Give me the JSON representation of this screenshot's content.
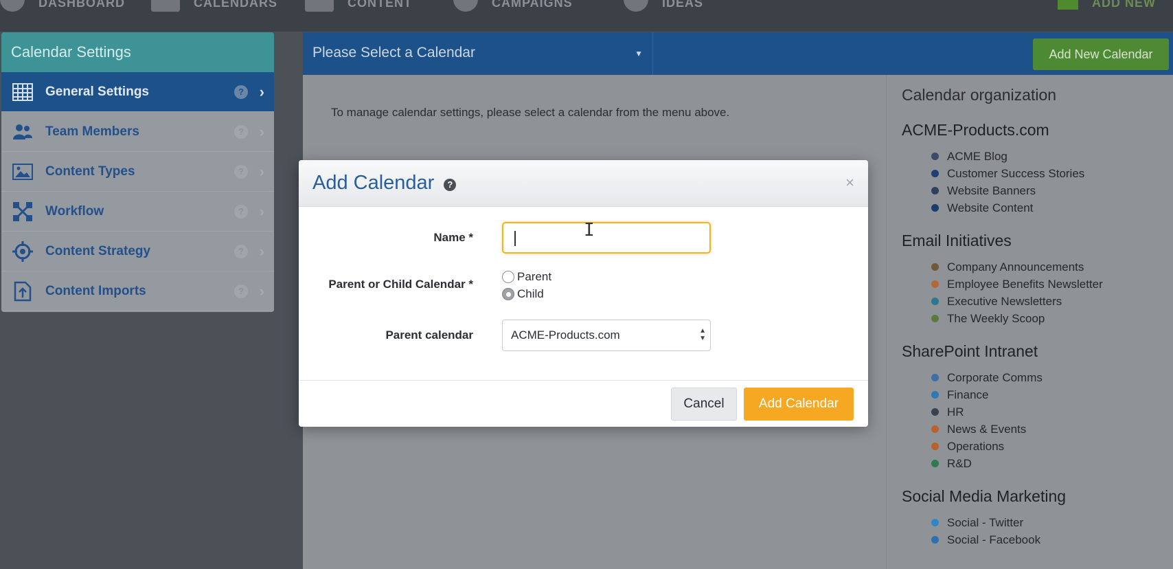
{
  "topnav": {
    "items": [
      {
        "label": "DASHBOARD",
        "icon": "dashboard-icon"
      },
      {
        "label": "CALENDARS",
        "icon": "calendar-grid-icon"
      },
      {
        "label": "CONTENT",
        "icon": "content-icon"
      },
      {
        "label": "CAMPAIGNS",
        "icon": "star-icon"
      },
      {
        "label": "IDEAS",
        "icon": "lightbulb-icon"
      }
    ],
    "add_new": "ADD NEW"
  },
  "sidebar": {
    "title": "Calendar Settings",
    "items": [
      {
        "label": "General Settings",
        "icon": "grid-icon",
        "active": true
      },
      {
        "label": "Team Members",
        "icon": "team-icon"
      },
      {
        "label": "Content Types",
        "icon": "image-icon"
      },
      {
        "label": "Workflow",
        "icon": "workflow-icon"
      },
      {
        "label": "Content Strategy",
        "icon": "target-icon"
      },
      {
        "label": "Content Imports",
        "icon": "import-icon"
      }
    ]
  },
  "main": {
    "calendar_select": "Please Select a Calendar",
    "add_new_calendar": "Add New Calendar",
    "message": "To manage calendar settings, please select a calendar from the menu above."
  },
  "organization": {
    "title": "Calendar organization",
    "groups": [
      {
        "name": "ACME-Products.com",
        "items": [
          {
            "label": "ACME Blog",
            "color": "#3b4a66"
          },
          {
            "label": "Customer Success Stories",
            "color": "#1f3f74"
          },
          {
            "label": "Website Banners",
            "color": "#2f3f5c"
          },
          {
            "label": "Website Content",
            "color": "#1d3c6e"
          }
        ]
      },
      {
        "name": "Email Initiatives",
        "items": [
          {
            "label": "Company Announcements",
            "color": "#6d5a3a"
          },
          {
            "label": "Employee Benefits Newsletter",
            "color": "#b3683a"
          },
          {
            "label": "Executive Newsletters",
            "color": "#2f7690"
          },
          {
            "label": "The Weekly Scoop",
            "color": "#5b7a3b"
          }
        ]
      },
      {
        "name": "SharePoint Intranet",
        "items": [
          {
            "label": "Corporate Comms",
            "color": "#3d6fa3"
          },
          {
            "label": "Finance",
            "color": "#2f78b0"
          },
          {
            "label": "HR",
            "color": "#3a4250"
          },
          {
            "label": "News & Events",
            "color": "#b8622e"
          },
          {
            "label": "Operations",
            "color": "#b8622e"
          },
          {
            "label": "R&D",
            "color": "#2e7a52"
          }
        ]
      },
      {
        "name": "Social Media Marketing",
        "items": [
          {
            "label": "Social - Twitter",
            "color": "#2f86c2"
          },
          {
            "label": "Social - Facebook",
            "color": "#2f6fb0"
          }
        ]
      }
    ]
  },
  "modal": {
    "title": "Add Calendar",
    "help": "?",
    "close": "×",
    "name_label": "Name *",
    "name_value": "",
    "parent_child_label": "Parent or Child Calendar *",
    "parent_option": "Parent",
    "child_option": "Child",
    "selected_option": "Child",
    "parent_calendar_label": "Parent calendar",
    "parent_calendar_value": "ACME-Products.com",
    "cancel": "Cancel",
    "submit": "Add Calendar"
  }
}
